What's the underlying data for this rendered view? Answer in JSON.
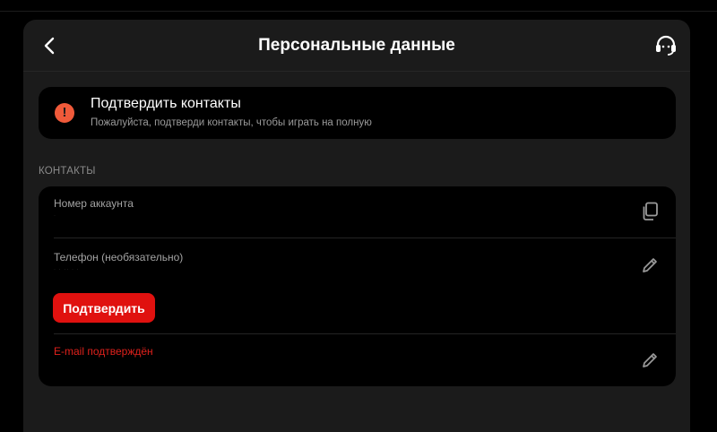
{
  "header": {
    "title": "Персональные данные"
  },
  "alert": {
    "title": "Подтвердить контакты",
    "subtitle": "Пожалуйста, подтверди контакты, чтобы играть на полную",
    "icon": "exclamation-icon",
    "icon_color": "#f05a3a"
  },
  "contacts": {
    "section_label": "КОНТАКТЫ",
    "account": {
      "label": "Номер аккаунта",
      "value": "·"
    },
    "phone": {
      "label": "Телефон (необязательно)",
      "value": "·  ·  ··  ·  ·",
      "confirm_label": "Подтвердить"
    },
    "email": {
      "status": "E-mail подтверждён"
    }
  },
  "colors": {
    "accent": "#e0110f",
    "background": "#000000",
    "panel": "#1b1b1b"
  }
}
